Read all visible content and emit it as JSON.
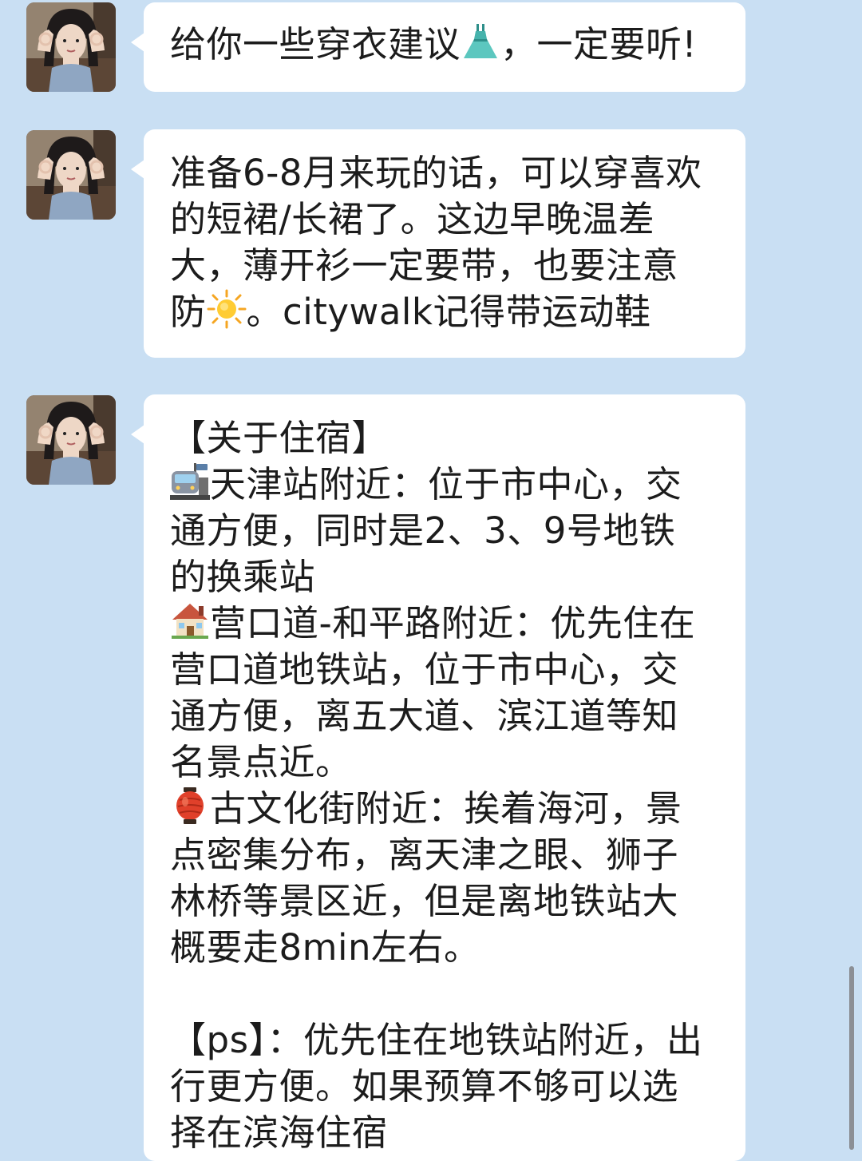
{
  "messages": [
    {
      "avatar_icon": "user-avatar-photo",
      "lines": [
        {
          "pre": "给你一些穿衣建议",
          "emoji": "dress-emoji",
          "post": "，一定要听!"
        }
      ]
    },
    {
      "avatar_icon": "user-avatar-photo",
      "lines": [
        {
          "text": "准备6-8月来玩的话，可以穿喜欢"
        },
        {
          "text": "的短裙/长裙了。这边早晚温差"
        },
        {
          "text": "大，薄开衫一定要带，也要注意"
        },
        {
          "pre": "防",
          "emoji": "sun-emoji",
          "post": "。citywalk记得带运动鞋"
        }
      ]
    },
    {
      "avatar_icon": "user-avatar-photo",
      "lines": [
        {
          "text": "【关于住宿】"
        },
        {
          "emoji": "train-station-emoji",
          "post": "天津站附近：位于市中心，交"
        },
        {
          "text": "通方便，同时是2、3、9号地铁"
        },
        {
          "text": "的换乘站"
        },
        {
          "emoji": "house-emoji",
          "post": "营口道-和平路附近：优先住在"
        },
        {
          "text": "营口道地铁站，位于市中心，交"
        },
        {
          "text": "通方便，离五大道、滨江道等知"
        },
        {
          "text": "名景点近。"
        },
        {
          "emoji": "lantern-emoji",
          "post": "古文化街附近：挨着海河，景"
        },
        {
          "text": "点密集分布，离天津之眼、狮子"
        },
        {
          "text": "林桥等景区近，但是离地铁站大"
        },
        {
          "text": "概要走8min左右。"
        },
        {
          "gap": true
        },
        {
          "text": "【ps】：优先住在地铁站附近，出"
        },
        {
          "text": "行更方便。如果预算不够可以选"
        },
        {
          "text": "择在滨海住宿"
        }
      ]
    }
  ],
  "colors": {
    "background": "#c9dff3",
    "bubble": "#ffffff",
    "text": "#1c1c1c"
  }
}
